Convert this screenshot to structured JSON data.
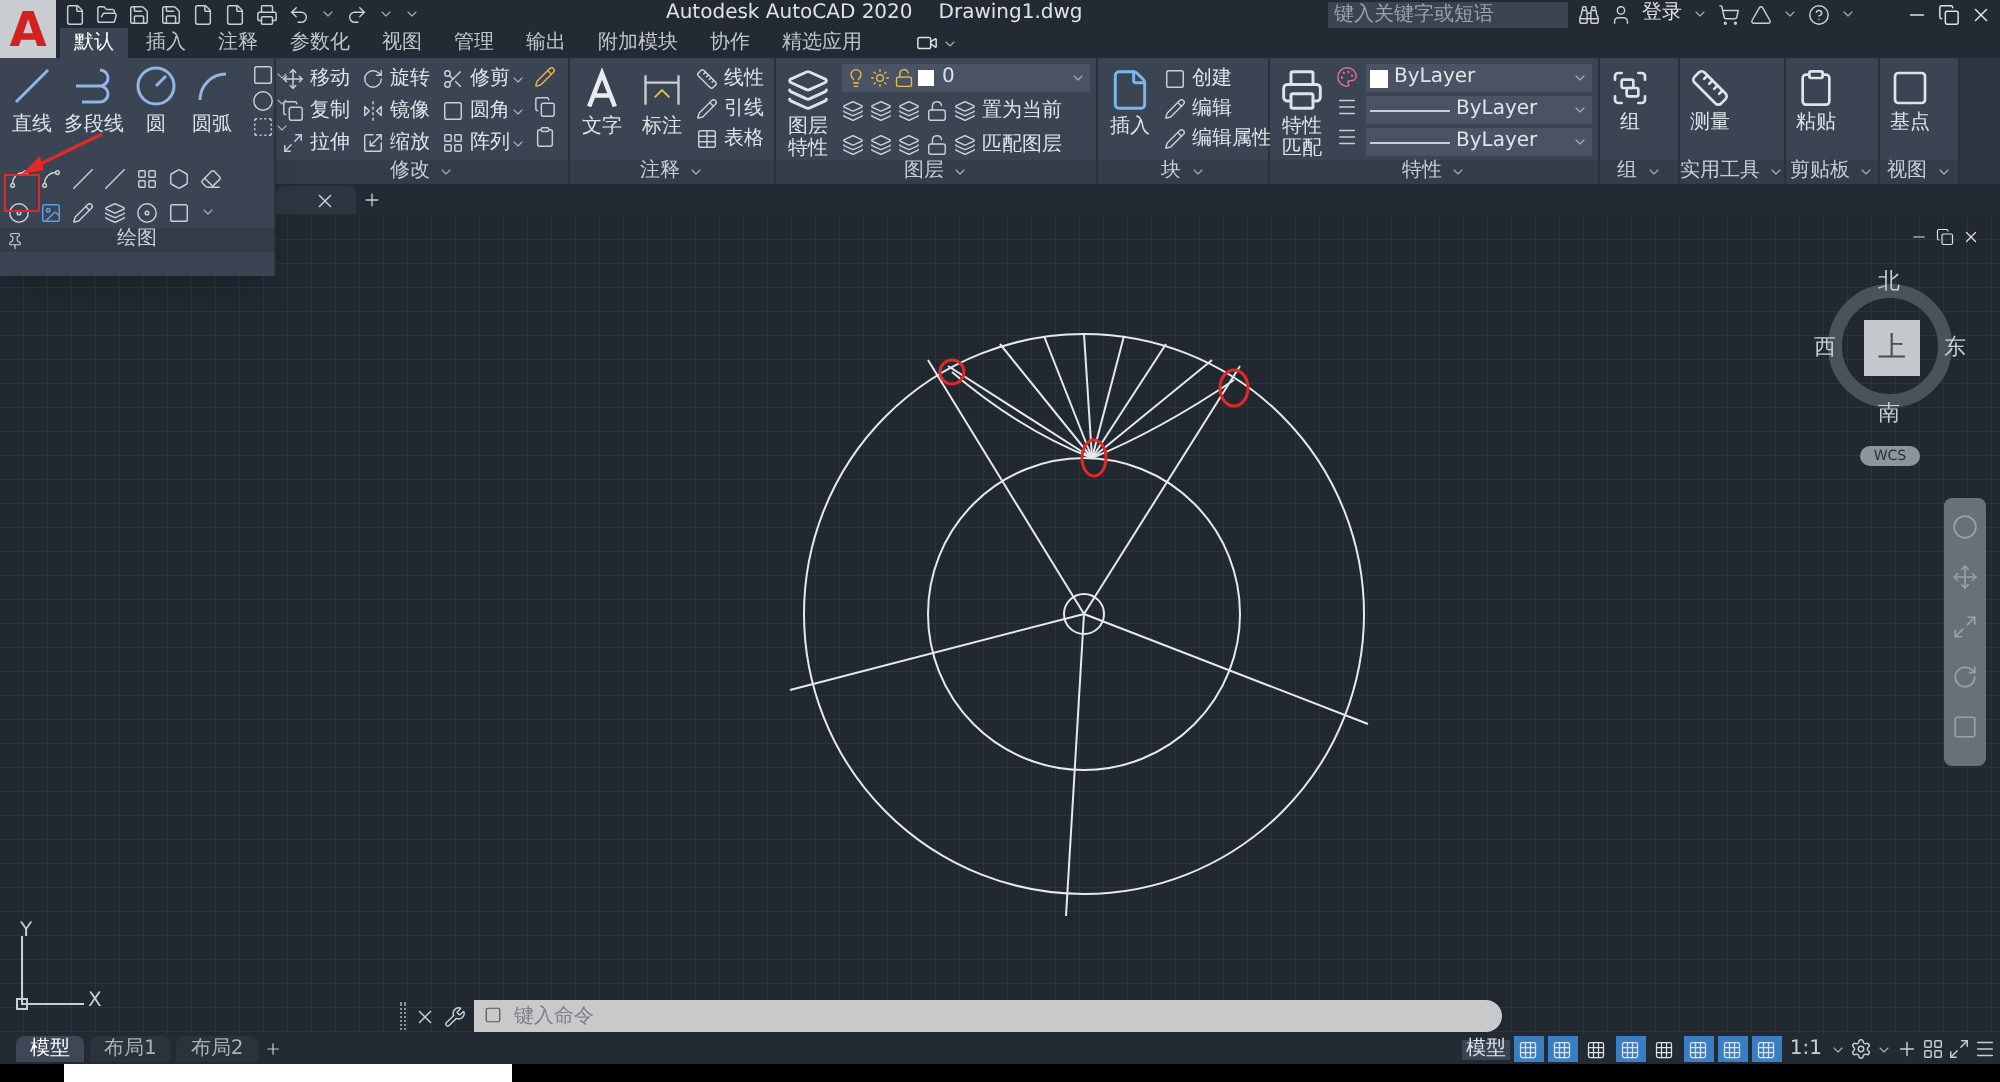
{
  "app_menu": {
    "label": "A"
  },
  "title_bar": {
    "title": "Autodesk AutoCAD 2020",
    "document": "Drawing1.dwg",
    "search": {
      "placeholder": "键入关键字或短语"
    },
    "sign_in": "登录"
  },
  "ribbon_tabs": [
    {
      "label": "默认",
      "selected": true
    },
    {
      "label": "插入",
      "selected": false
    },
    {
      "label": "注释",
      "selected": false
    },
    {
      "label": "参数化",
      "selected": false
    },
    {
      "label": "视图",
      "selected": false
    },
    {
      "label": "管理",
      "selected": false
    },
    {
      "label": "输出",
      "selected": false
    },
    {
      "label": "附加模块",
      "selected": false
    },
    {
      "label": "协作",
      "selected": false
    },
    {
      "label": "精选应用",
      "selected": false
    }
  ],
  "panels": [
    {
      "kind": "draw",
      "title": "绘图",
      "expanded": true,
      "large_tools": [
        "直线",
        "多段线",
        "圆",
        "圆弧"
      ]
    },
    {
      "kind": "modify",
      "title": "修改",
      "small_tools": [
        "移动",
        "旋转",
        "修剪",
        "复制",
        "镜像",
        "圆角",
        "拉伸",
        "缩放",
        "阵列"
      ]
    },
    {
      "kind": "annotate",
      "title": "注释",
      "large_tools": [
        "文字",
        "标注"
      ],
      "small_tools": [
        "线性",
        "引线",
        "表格"
      ]
    },
    {
      "kind": "layers",
      "title": "图层",
      "large_tools": [
        "图层特性"
      ],
      "layer": "0",
      "small_tools": [
        "置为当前",
        "匹配图层"
      ]
    },
    {
      "kind": "block",
      "title": "块",
      "large_tools": [
        "插入"
      ],
      "small_tools": [
        "创建",
        "编辑",
        "编辑属性"
      ]
    },
    {
      "kind": "properties",
      "title": "特性",
      "large_tools": [
        "特性匹配"
      ],
      "dropdowns": [
        "ByLayer",
        "ByLayer",
        "ByLayer"
      ]
    },
    {
      "kind": "simple",
      "title": "组",
      "large_tools": [
        "组"
      ]
    },
    {
      "kind": "simple",
      "title": "实用工具",
      "large_tools": [
        "测量"
      ]
    },
    {
      "kind": "simple",
      "title": "剪贴板",
      "large_tools": [
        "粘贴"
      ]
    },
    {
      "kind": "simple",
      "title": "视图",
      "large_tools": [
        "基点"
      ]
    }
  ],
  "viewcube": {
    "north": "北",
    "south": "南",
    "east": "东",
    "west": "西",
    "face": "上",
    "ucs": "WCS"
  },
  "ucs_icon": {
    "x": "X",
    "y": "Y"
  },
  "command_line": {
    "placeholder": "键入命令"
  },
  "layout_tabs": [
    {
      "label": "模型",
      "selected": true
    },
    {
      "label": "布局1",
      "selected": false
    },
    {
      "label": "布局2",
      "selected": false
    }
  ],
  "status_bar": {
    "space": "模型",
    "toggles": [
      {
        "on": true
      },
      {
        "on": true
      },
      {
        "on": false
      },
      {
        "on": true
      },
      {
        "on": false
      },
      {
        "on": true
      },
      {
        "on": true
      },
      {
        "on": true
      }
    ],
    "scale": "1:1"
  }
}
